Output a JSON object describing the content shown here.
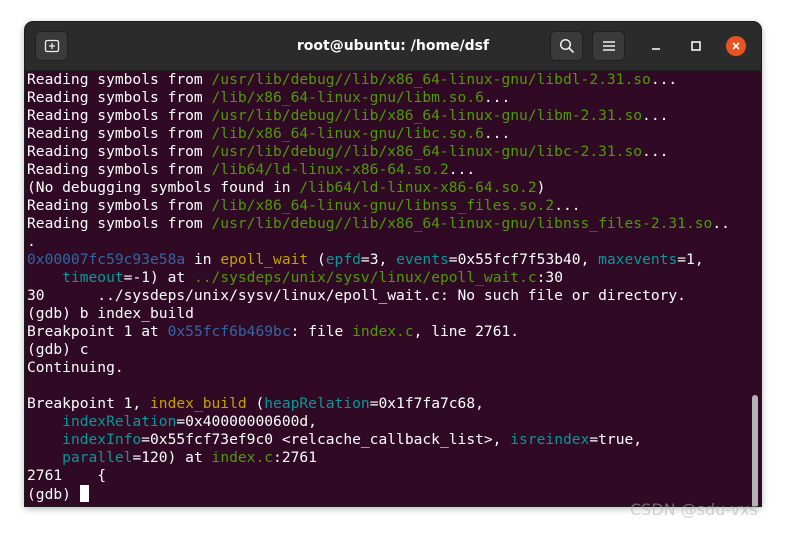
{
  "window": {
    "title": "root@ubuntu: /home/dsf"
  },
  "icons": {
    "new_tab": "new-tab-icon",
    "search": "search-icon",
    "menu": "hamburger-menu-icon",
    "minimize": "minimize-icon",
    "maximize": "maximize-icon",
    "close": "close-icon"
  },
  "colors": {
    "terminal_bg": "#300a24",
    "titlebar_bg": "#2b2b2b",
    "path_green": "#4e9a06",
    "address_blue": "#3465a4",
    "function_yellow": "#c4a000",
    "param_cyan": "#06989a",
    "close_orange": "#e95420"
  },
  "terminal": {
    "lines": [
      [
        {
          "t": "Reading symbols from ",
          "c": "w"
        },
        {
          "t": "/usr/lib/debug//lib/x86_64-linux-gnu/libdl-2.31.so",
          "c": "g"
        },
        {
          "t": "...",
          "c": "w"
        }
      ],
      [
        {
          "t": "Reading symbols from ",
          "c": "w"
        },
        {
          "t": "/lib/x86_64-linux-gnu/libm.so.6",
          "c": "g"
        },
        {
          "t": "...",
          "c": "w"
        }
      ],
      [
        {
          "t": "Reading symbols from ",
          "c": "w"
        },
        {
          "t": "/usr/lib/debug//lib/x86_64-linux-gnu/libm-2.31.so",
          "c": "g"
        },
        {
          "t": "...",
          "c": "w"
        }
      ],
      [
        {
          "t": "Reading symbols from ",
          "c": "w"
        },
        {
          "t": "/lib/x86_64-linux-gnu/libc.so.6",
          "c": "g"
        },
        {
          "t": "...",
          "c": "w"
        }
      ],
      [
        {
          "t": "Reading symbols from ",
          "c": "w"
        },
        {
          "t": "/usr/lib/debug//lib/x86_64-linux-gnu/libc-2.31.so",
          "c": "g"
        },
        {
          "t": "...",
          "c": "w"
        }
      ],
      [
        {
          "t": "Reading symbols from ",
          "c": "w"
        },
        {
          "t": "/lib64/ld-linux-x86-64.so.2",
          "c": "g"
        },
        {
          "t": "...",
          "c": "w"
        }
      ],
      [
        {
          "t": "(No debugging symbols found in ",
          "c": "w"
        },
        {
          "t": "/lib64/ld-linux-x86-64.so.2",
          "c": "g"
        },
        {
          "t": ")",
          "c": "w"
        }
      ],
      [
        {
          "t": "Reading symbols from ",
          "c": "w"
        },
        {
          "t": "/lib/x86_64-linux-gnu/libnss_files.so.2",
          "c": "g"
        },
        {
          "t": "...",
          "c": "w"
        }
      ],
      [
        {
          "t": "Reading symbols from ",
          "c": "w"
        },
        {
          "t": "/usr/lib/debug//lib/x86_64-linux-gnu/libnss_files-2.31.so",
          "c": "g"
        },
        {
          "t": "..",
          "c": "w"
        }
      ],
      [
        {
          "t": ".",
          "c": "w"
        }
      ],
      [
        {
          "t": "0x00007fc59c93e58a",
          "c": "b"
        },
        {
          "t": " in ",
          "c": "w"
        },
        {
          "t": "epoll_wait",
          "c": "y"
        },
        {
          "t": " (",
          "c": "w"
        },
        {
          "t": "epfd",
          "c": "c"
        },
        {
          "t": "=3, ",
          "c": "w"
        },
        {
          "t": "events",
          "c": "c"
        },
        {
          "t": "=0x55fcf7f53b40, ",
          "c": "w"
        },
        {
          "t": "maxevents",
          "c": "c"
        },
        {
          "t": "=1,",
          "c": "w"
        }
      ],
      [
        {
          "t": "    ",
          "c": "w"
        },
        {
          "t": "timeout",
          "c": "c"
        },
        {
          "t": "=-1) at ",
          "c": "w"
        },
        {
          "t": "../sysdeps/unix/sysv/linux/epoll_wait.c",
          "c": "g"
        },
        {
          "t": ":30",
          "c": "w"
        }
      ],
      [
        {
          "t": "30      ../sysdeps/unix/sysv/linux/epoll_wait.c: No such file or directory.",
          "c": "w"
        }
      ],
      [
        {
          "t": "(gdb) b index_build",
          "c": "w"
        }
      ],
      [
        {
          "t": "Breakpoint 1 at ",
          "c": "w"
        },
        {
          "t": "0x55fcf6b469bc",
          "c": "b"
        },
        {
          "t": ": file ",
          "c": "w"
        },
        {
          "t": "index.c",
          "c": "g"
        },
        {
          "t": ", line 2761.",
          "c": "w"
        }
      ],
      [
        {
          "t": "(gdb) c",
          "c": "w"
        }
      ],
      [
        {
          "t": "Continuing.",
          "c": "w"
        }
      ],
      [
        {
          "t": "",
          "c": "w"
        }
      ],
      [
        {
          "t": "Breakpoint 1, ",
          "c": "w"
        },
        {
          "t": "index_build",
          "c": "y"
        },
        {
          "t": " (",
          "c": "w"
        },
        {
          "t": "heapRelation",
          "c": "c"
        },
        {
          "t": "=0x1f7fa7c68,",
          "c": "w"
        }
      ],
      [
        {
          "t": "    ",
          "c": "w"
        },
        {
          "t": "indexRelation",
          "c": "c"
        },
        {
          "t": "=0x40000000600d,",
          "c": "w"
        }
      ],
      [
        {
          "t": "    ",
          "c": "w"
        },
        {
          "t": "indexInfo",
          "c": "c"
        },
        {
          "t": "=0x55fcf73ef9c0 <relcache_callback_list>, ",
          "c": "w"
        },
        {
          "t": "isreindex",
          "c": "c"
        },
        {
          "t": "=true,",
          "c": "w"
        }
      ],
      [
        {
          "t": "    ",
          "c": "w"
        },
        {
          "t": "parallel",
          "c": "c"
        },
        {
          "t": "=120) at ",
          "c": "w"
        },
        {
          "t": "index.c",
          "c": "g"
        },
        {
          "t": ":2761",
          "c": "w"
        }
      ],
      [
        {
          "t": "2761    {",
          "c": "w"
        }
      ],
      [
        {
          "t": "(gdb) ",
          "c": "w"
        }
      ]
    ]
  },
  "watermark": "CSDN @sdu-vxs"
}
